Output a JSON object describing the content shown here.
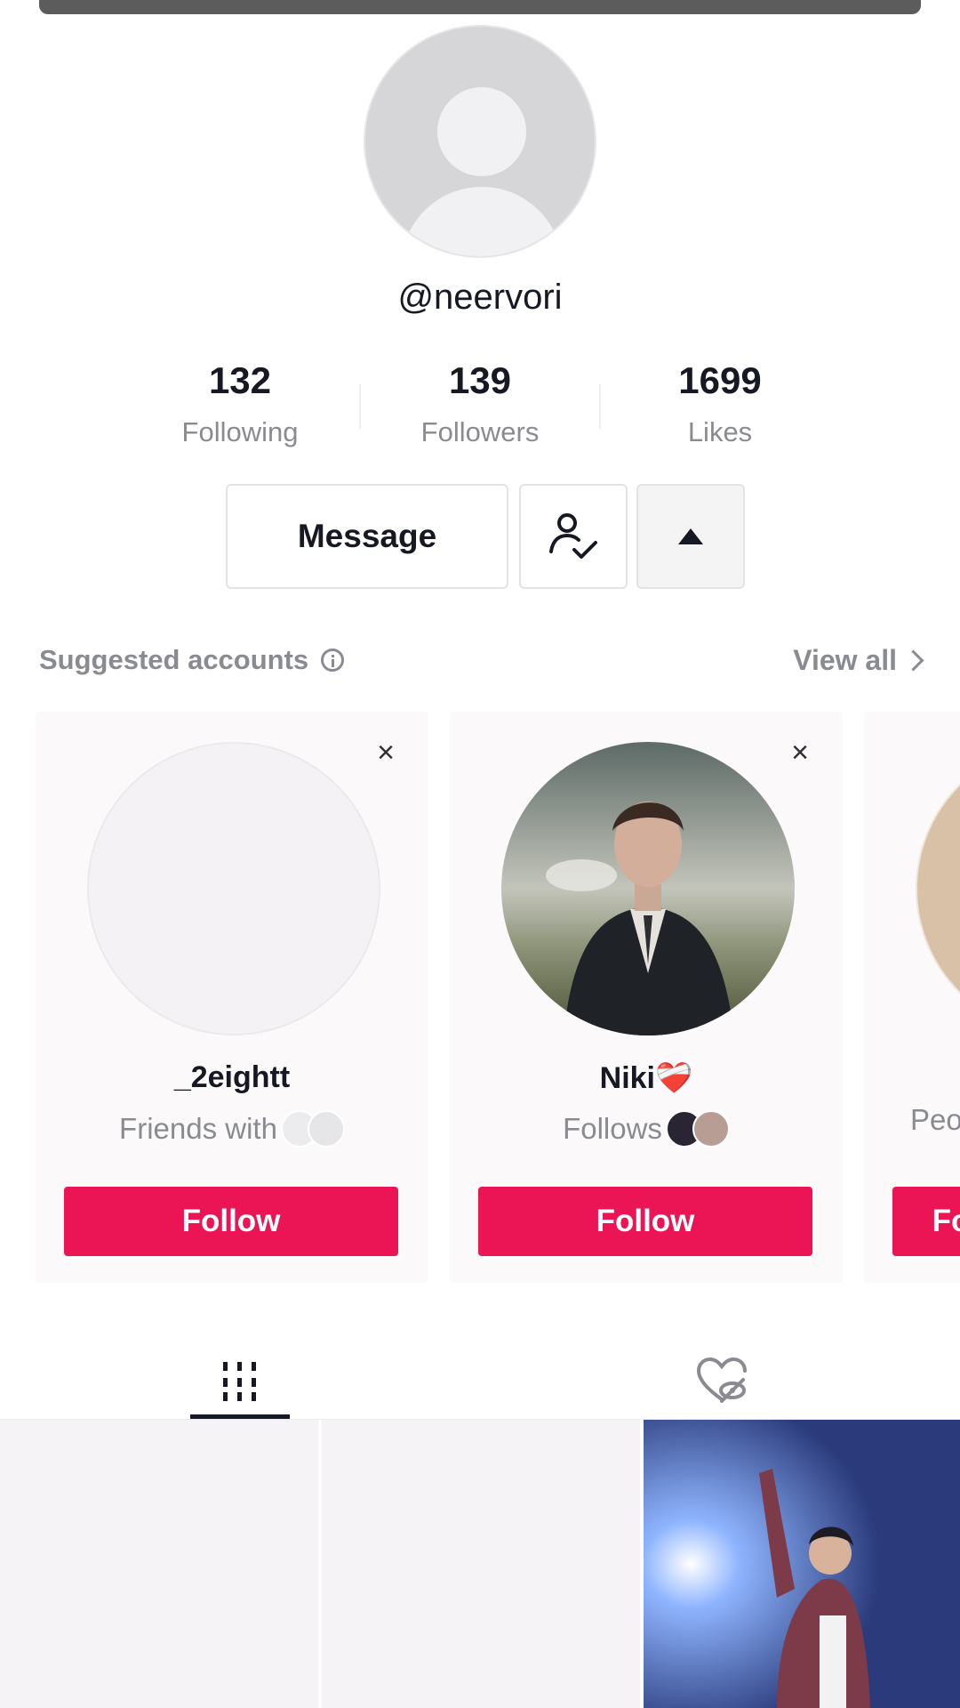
{
  "profile": {
    "username": "@neervori",
    "stats": [
      {
        "value": "132",
        "label": "Following"
      },
      {
        "value": "139",
        "label": "Followers"
      },
      {
        "value": "1699",
        "label": "Likes"
      }
    ]
  },
  "actions": {
    "message_label": "Message",
    "friend_icon": "person-check-icon",
    "more_icon": "triangle-up-icon"
  },
  "suggested": {
    "title": "Suggested accounts",
    "view_all": "View all",
    "cards": [
      {
        "name": "_2eightt",
        "subtitle": "Friends with",
        "follow_label": "Follow",
        "avatar": "blank-avatar"
      },
      {
        "name": "Niki❤️‍🩹",
        "subtitle": "Follows",
        "follow_label": "Follow",
        "avatar": "man-in-suit-photo"
      },
      {
        "name": "",
        "subtitle": "Peo",
        "follow_label": "Follow",
        "avatar": "partial-photo"
      }
    ]
  },
  "tabs": [
    {
      "name": "videos",
      "icon": "grid-icon"
    },
    {
      "name": "liked",
      "icon": "hidden-heart-icon"
    }
  ],
  "colors": {
    "accent": "#eb1555",
    "text_primary": "#161823",
    "text_secondary": "#8a8b91"
  }
}
